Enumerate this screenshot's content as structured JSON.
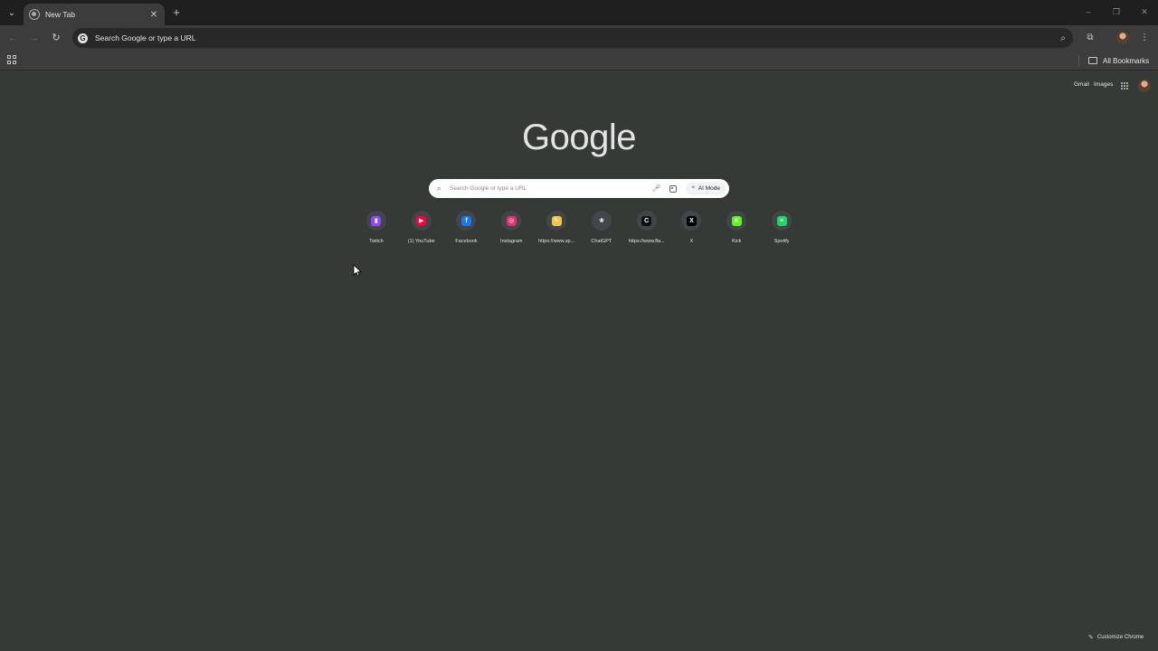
{
  "tab_strip": {
    "tab_title": "New Tab",
    "icons": {
      "tab_search": "chevron-down-icon",
      "tab_close": "close-icon",
      "new_tab": "plus-icon",
      "minimize": "minimize-icon",
      "restore": "restore-icon",
      "close_window": "close-icon"
    }
  },
  "toolbar": {
    "omnibox_text": "Search Google or type a URL",
    "icons": {
      "back": "back-arrow-icon",
      "forward": "forward-arrow-icon",
      "reload": "reload-icon",
      "zoom": "zoom-icon",
      "extensions": "puzzle-piece-icon",
      "profile": "avatar",
      "menu": "kebab-menu-icon"
    }
  },
  "bookmarks_bar": {
    "all_bookmarks_label": "All Bookmarks"
  },
  "ntp": {
    "logo_text": "Google",
    "gmail_label": "Gmail",
    "images_label": "Images",
    "search_placeholder": "Search Google or type a URL",
    "ai_mode_label": "AI Mode",
    "shortcuts": [
      {
        "title": "Twitch",
        "icon": "twitch-icon",
        "color": "#9146ff",
        "glyph": "▮"
      },
      {
        "title": "(1) YouTube",
        "icon": "youtube-icon",
        "color": "#ff0033",
        "glyph": "▶"
      },
      {
        "title": "Facebook",
        "icon": "facebook-icon",
        "color": "#1877f2",
        "glyph": "f"
      },
      {
        "title": "Instagram",
        "icon": "instagram-icon",
        "color": "#e1306c",
        "glyph": "◎"
      },
      {
        "title": "https://www.sp...",
        "icon": "notes-icon",
        "color": "#f4c542",
        "glyph": "✎"
      },
      {
        "title": "ChatGPT",
        "icon": "chatgpt-icon",
        "color": "#42464a",
        "glyph": "❀"
      },
      {
        "title": "https://www.fla...",
        "icon": "circle-c-icon",
        "color": "#111111",
        "glyph": "C"
      },
      {
        "title": "X",
        "icon": "x-icon",
        "color": "#000000",
        "glyph": "X"
      },
      {
        "title": "Kick",
        "icon": "kick-icon",
        "color": "#53fc18",
        "glyph": "K"
      },
      {
        "title": "Spotify",
        "icon": "spotify-icon",
        "color": "#1ed760",
        "glyph": "≡"
      }
    ],
    "customize_label": "Customize Chrome"
  }
}
